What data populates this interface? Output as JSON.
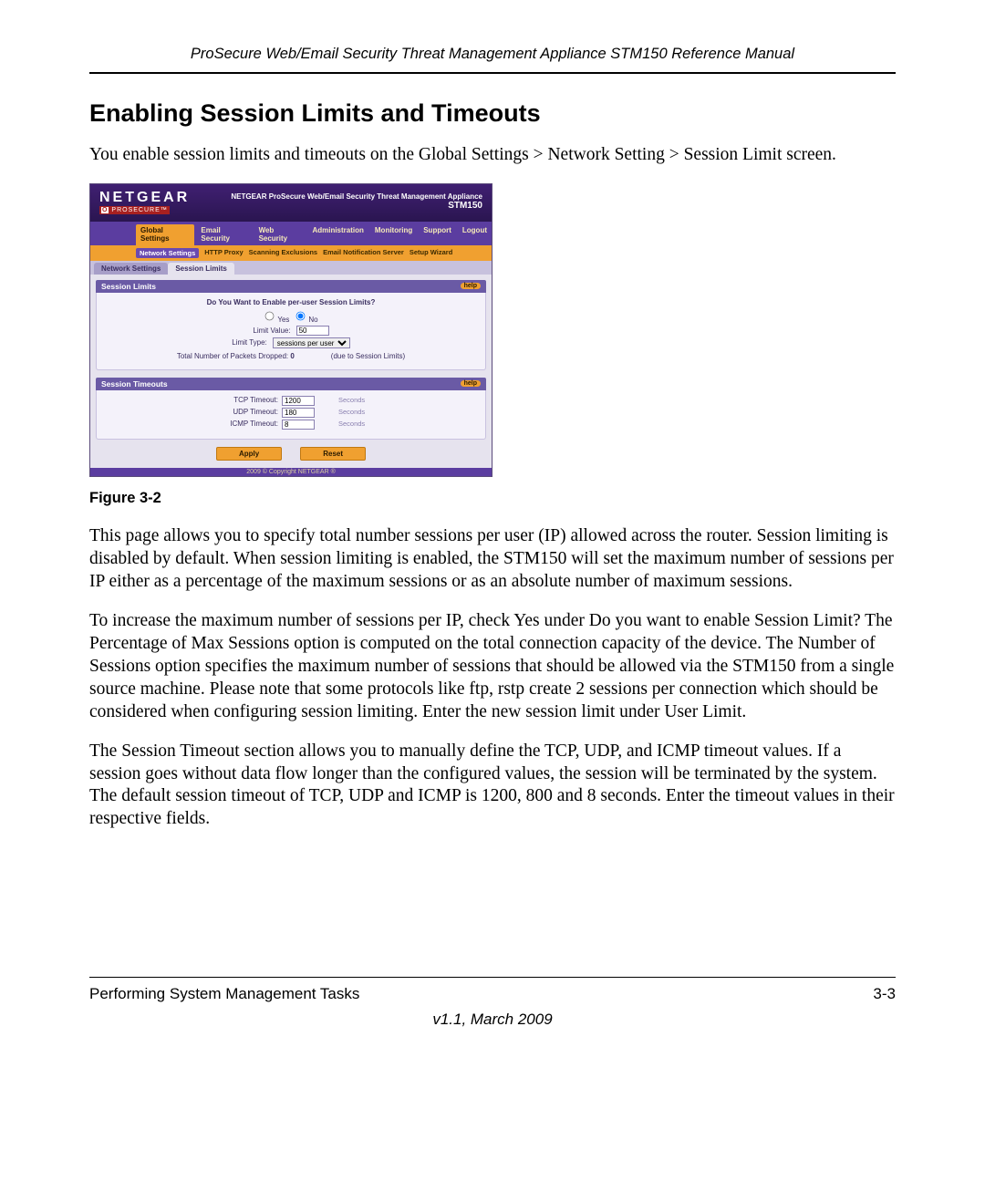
{
  "header": {
    "running": "ProSecure Web/Email Security Threat Management Appliance STM150 Reference Manual"
  },
  "section": {
    "title": "Enabling Session Limits and Timeouts",
    "intro": "You enable session limits and timeouts on the Global Settings > Network Setting > Session Limit screen."
  },
  "figure": {
    "caption": "Figure 3-2"
  },
  "body": {
    "p1": "This page allows you to specify total number sessions per user (IP) allowed across the router. Session limiting is disabled by default. When session limiting is enabled, the STM150 will set the maximum number of sessions per IP either as a percentage of the maximum sessions or as an absolute number of maximum sessions.",
    "p2": "To increase the maximum number of sessions per IP, check Yes under Do you want to enable Session Limit? The Percentage of Max Sessions option is computed on the total connection capacity of the device. The Number of Sessions option specifies the maximum number of sessions that should be allowed via the STM150 from a single source machine. Please note that some protocols like ftp, rstp create 2 sessions per connection which should be considered when configuring session limiting. Enter the new session limit under User Limit.",
    "p3": "The Session Timeout section allows you to manually define the TCP, UDP, and ICMP timeout values. If a session goes without data flow longer than the configured values, the session will be terminated by the system. The default session timeout of TCP, UDP and ICMP is 1200, 800 and 8 seconds. Enter the timeout values in their respective fields."
  },
  "footer": {
    "left": "Performing System Management Tasks",
    "right": "3-3",
    "version": "v1.1, March 2009"
  },
  "shot": {
    "brand": "NETGEAR",
    "brand_sub_prefix": "O",
    "brand_sub": "PROSECURE",
    "product_line": "NETGEAR ProSecure Web/Email Security Threat Management Appliance",
    "model": "STM150",
    "main_tabs": {
      "t0": "Global Settings",
      "t1": "Email Security",
      "t2": "Web Security",
      "t3": "Administration",
      "t4": "Monitoring",
      "t5": "Support",
      "t6": "Logout"
    },
    "sub_tabs": {
      "s0": "Network Settings",
      "s1": "HTTP Proxy",
      "s2": "Scanning Exclusions",
      "s3": "Email Notification Server",
      "s4": "Setup Wizard"
    },
    "page_tabs": {
      "p0": "Network Settings",
      "p1": "Session Limits"
    },
    "panel_limits": {
      "title": "Session Limits",
      "help": "help",
      "question": "Do You Want to Enable per-user Session Limits?",
      "yes": "Yes",
      "no": "No",
      "limit_value_label": "Limit Value:",
      "limit_value": "50",
      "limit_type_label": "Limit Type:",
      "limit_type": "sessions per user",
      "packets_label": "Total Number of Packets Dropped:",
      "packets_value": "0",
      "packets_note": "(due to Session Limits)"
    },
    "panel_timeouts": {
      "title": "Session Timeouts",
      "help": "help",
      "tcp_label": "TCP Timeout:",
      "tcp_value": "1200",
      "udp_label": "UDP Timeout:",
      "udp_value": "180",
      "icmp_label": "ICMP Timeout:",
      "icmp_value": "8",
      "unit": "Seconds"
    },
    "buttons": {
      "apply": "Apply",
      "reset": "Reset"
    },
    "copyright": "2009 © Copyright NETGEAR ®"
  }
}
